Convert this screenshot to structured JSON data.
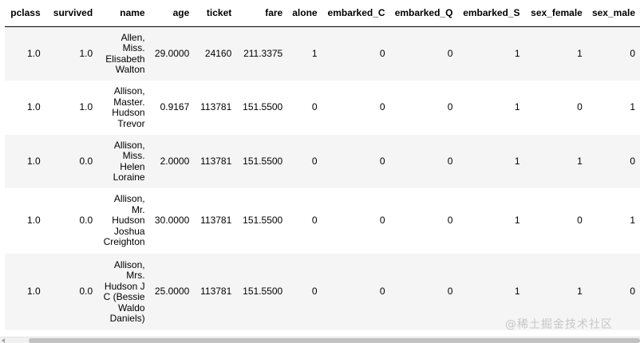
{
  "columns": [
    "pclass",
    "survived",
    "name",
    "age",
    "ticket",
    "fare",
    "alone",
    "embarked_C",
    "embarked_Q",
    "embarked_S",
    "sex_female",
    "sex_male"
  ],
  "rows": [
    [
      "1.0",
      "1.0",
      "Allen, Miss. Elisabeth Walton",
      "29.0000",
      "24160",
      "211.3375",
      "1",
      "0",
      "0",
      "1",
      "1",
      "0"
    ],
    [
      "1.0",
      "1.0",
      "Allison, Master. Hudson Trevor",
      "0.9167",
      "113781",
      "151.5500",
      "0",
      "0",
      "0",
      "1",
      "0",
      "1"
    ],
    [
      "1.0",
      "0.0",
      "Allison, Miss. Helen Loraine",
      "2.0000",
      "113781",
      "151.5500",
      "0",
      "0",
      "0",
      "1",
      "1",
      "0"
    ],
    [
      "1.0",
      "0.0",
      "Allison, Mr. Hudson Joshua Creighton",
      "30.0000",
      "113781",
      "151.5500",
      "0",
      "0",
      "0",
      "1",
      "0",
      "1"
    ],
    [
      "1.0",
      "0.0",
      "Allison, Mrs. Hudson J C (Bessie Waldo Daniels)",
      "25.0000",
      "113781",
      "151.5500",
      "0",
      "0",
      "0",
      "1",
      "1",
      "0"
    ]
  ],
  "watermark": "@稀土掘金技术社区"
}
